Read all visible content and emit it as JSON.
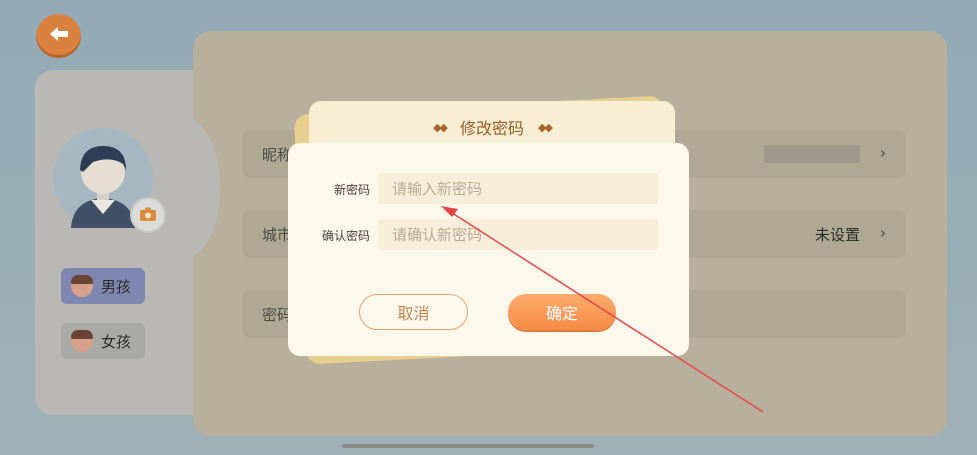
{
  "profile": {
    "rows": [
      {
        "label": "昵称",
        "value": ""
      },
      {
        "label": "城市",
        "value": "未设置"
      },
      {
        "label": "密码",
        "value": ""
      }
    ],
    "gender": {
      "boy": "男孩",
      "girl": "女孩"
    }
  },
  "dialog": {
    "title": "修改密码",
    "new_password_label": "新密码",
    "new_password_placeholder": "请输入新密码",
    "confirm_password_label": "确认密码",
    "confirm_password_placeholder": "请确认新密码",
    "cancel_label": "取消",
    "ok_label": "确定"
  },
  "icons": {
    "back": "back-arrow-icon",
    "camera": "camera-icon",
    "chevron": "chevron-right-icon"
  },
  "colors": {
    "accent": "#f58a45",
    "title": "#9b5e26",
    "annotation_arrow": "#e8474a"
  }
}
